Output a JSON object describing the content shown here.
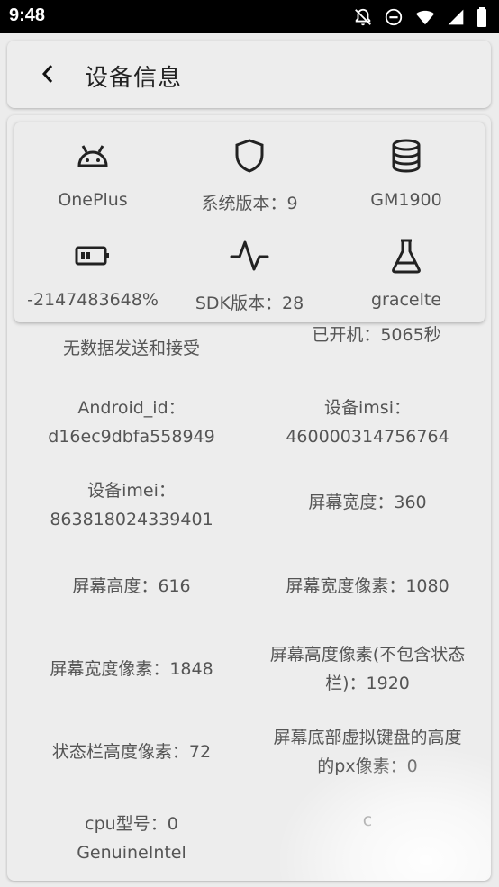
{
  "status_bar": {
    "time": "9:48"
  },
  "header": {
    "title": "设备信息"
  },
  "card": {
    "tiles": [
      {
        "icon": "android-icon",
        "label": "OnePlus"
      },
      {
        "icon": "shield-icon",
        "label": "系统版本：9"
      },
      {
        "icon": "database-icon",
        "label": "GM1900"
      },
      {
        "icon": "battery-icon",
        "label": "-2147483648%"
      },
      {
        "icon": "activity-icon",
        "label": "SDK版本：28"
      },
      {
        "icon": "flask-icon",
        "label": "gracelte"
      }
    ]
  },
  "info": {
    "peek_left": "无数据发送和接受",
    "peek_right": "已开机：5065秒",
    "rows": [
      {
        "left": "Android_id：\nd16ec9dbfa558949",
        "right": "设备imsi：\n460000314756764"
      },
      {
        "left": "设备imei：\n863818024339401",
        "right": "屏幕宽度：360"
      },
      {
        "left": "屏幕高度：616",
        "right": "屏幕宽度像素：1080"
      },
      {
        "left": "屏幕宽度像素：1848",
        "right": "屏幕高度像素(不包含状态\n栏)：1920"
      },
      {
        "left": "状态栏高度像素：72",
        "right": "屏幕底部虚拟键盘的高度\n的px像素：0"
      },
      {
        "left": "cpu型号：0\nGenuineIntel",
        "right": "c"
      }
    ]
  }
}
